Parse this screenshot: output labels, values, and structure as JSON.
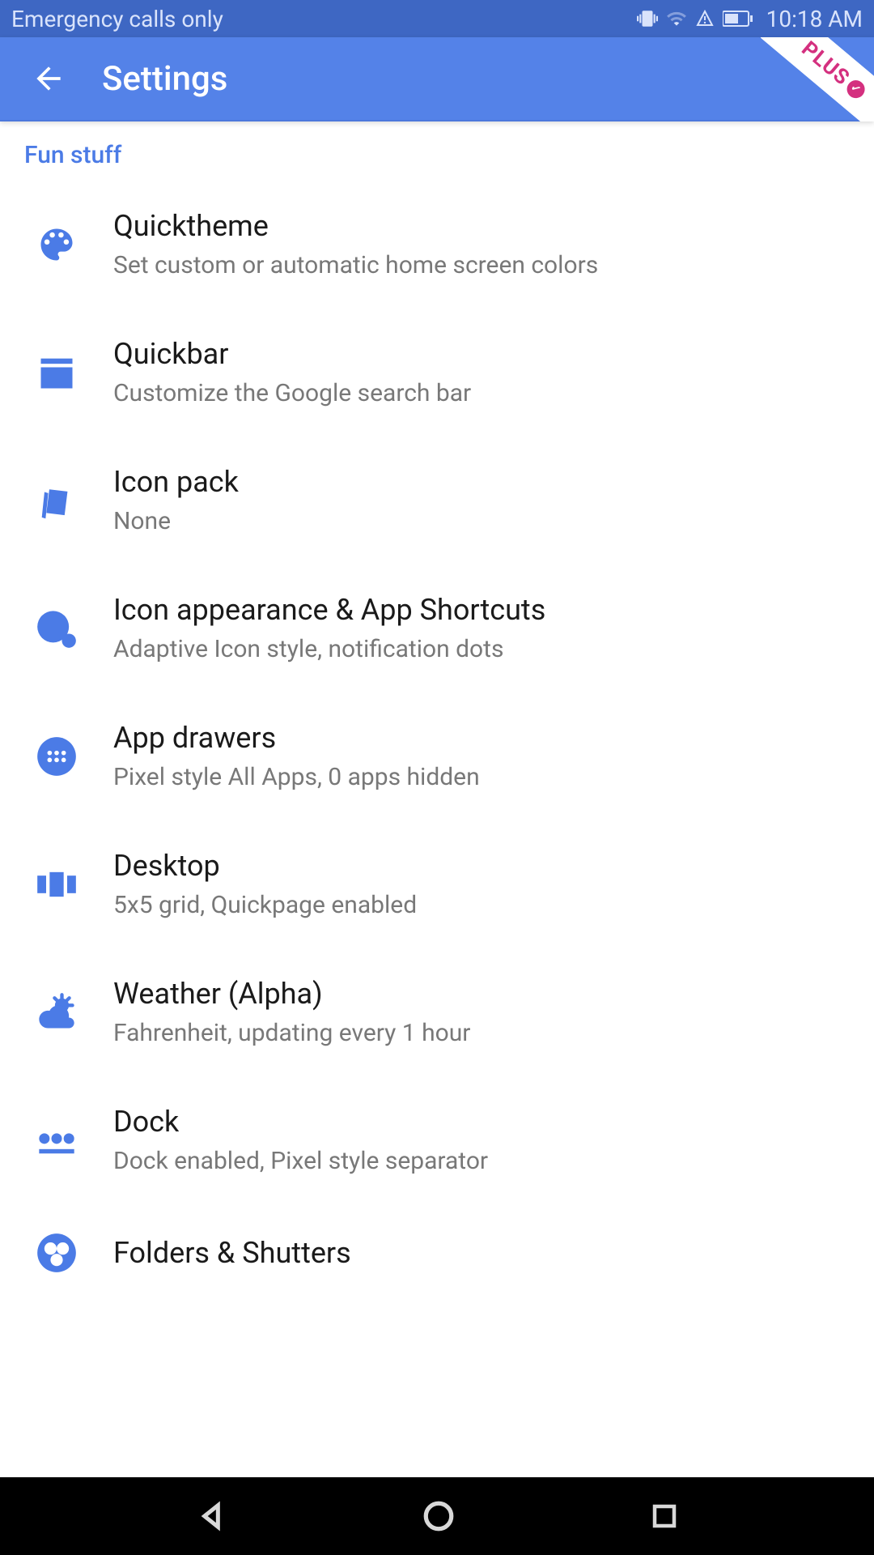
{
  "status": {
    "carrier": "Emergency calls only",
    "time": "10:18 AM"
  },
  "appbar": {
    "title": "Settings",
    "ribbon": "PLUS"
  },
  "section": {
    "header": "Fun stuff"
  },
  "items": [
    {
      "icon": "palette-icon",
      "title": "Quicktheme",
      "sub": "Set custom or automatic home screen colors"
    },
    {
      "icon": "quickbar-icon",
      "title": "Quickbar",
      "sub": "Customize the Google search bar"
    },
    {
      "icon": "iconpack-icon",
      "title": "Icon pack",
      "sub": "None"
    },
    {
      "icon": "appearance-icon",
      "title": "Icon appearance & App Shortcuts",
      "sub": "Adaptive Icon style, notification dots"
    },
    {
      "icon": "appdrawer-icon",
      "title": "App drawers",
      "sub": "Pixel style All Apps, 0 apps hidden"
    },
    {
      "icon": "desktop-icon",
      "title": "Desktop",
      "sub": "5x5 grid, Quickpage enabled"
    },
    {
      "icon": "weather-icon",
      "title": "Weather (Alpha)",
      "sub": "Fahrenheit, updating every 1 hour"
    },
    {
      "icon": "dock-icon",
      "title": "Dock",
      "sub": "Dock enabled, Pixel style separator"
    },
    {
      "icon": "folders-icon",
      "title": "Folders & Shutters",
      "sub": ""
    }
  ]
}
